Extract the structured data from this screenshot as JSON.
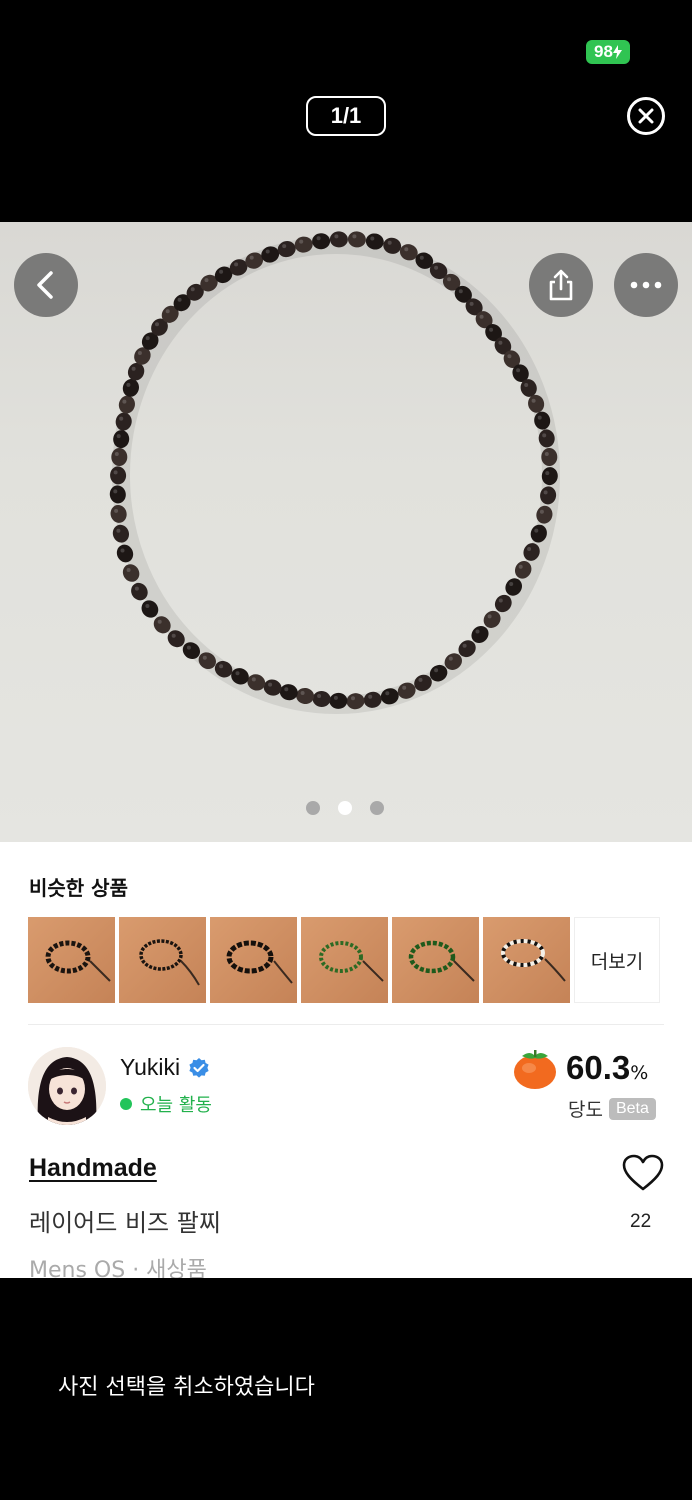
{
  "status": {
    "battery": "98"
  },
  "viewer": {
    "counter": "1/1"
  },
  "photo": {
    "dots_count": 3,
    "active_dot": 1
  },
  "similar": {
    "title": "비슷한 상품",
    "more_label": "더보기"
  },
  "seller": {
    "name": "Yukiki",
    "activity": "오늘 활동"
  },
  "sweetness": {
    "value": "60.3",
    "unit": "%",
    "label": "당도",
    "badge": "Beta"
  },
  "product": {
    "brand": "Handmade",
    "title": "레이어드 비즈 팔찌",
    "meta": "Mens OS · 새상품",
    "likes": "22"
  },
  "toast": {
    "message": "사진 선택을 취소하였습니다"
  }
}
